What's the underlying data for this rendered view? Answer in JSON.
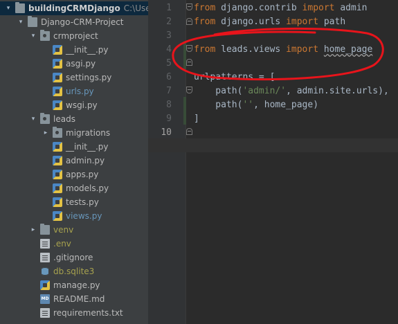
{
  "tree": {
    "items": [
      {
        "label": "buildingCRMDjango",
        "path": "C:\\Users\\d",
        "kind": "folder",
        "arrow": "▾",
        "style": "bold"
      },
      {
        "label": "Django-CRM-Project",
        "kind": "folder",
        "arrow": "▾"
      },
      {
        "label": "crmproject",
        "kind": "pkg",
        "arrow": "▾"
      },
      {
        "label": "__init__.py",
        "kind": "py"
      },
      {
        "label": "asgi.py",
        "kind": "py"
      },
      {
        "label": "settings.py",
        "kind": "py"
      },
      {
        "label": "urls.py",
        "kind": "py",
        "style": "blue"
      },
      {
        "label": "wsgi.py",
        "kind": "py"
      },
      {
        "label": "leads",
        "kind": "pkg",
        "arrow": "▾"
      },
      {
        "label": "migrations",
        "kind": "pkg",
        "arrow": "▸"
      },
      {
        "label": "__init__.py",
        "kind": "py"
      },
      {
        "label": "admin.py",
        "kind": "py"
      },
      {
        "label": "apps.py",
        "kind": "py"
      },
      {
        "label": "models.py",
        "kind": "py"
      },
      {
        "label": "tests.py",
        "kind": "py"
      },
      {
        "label": "views.py",
        "kind": "py",
        "style": "blue"
      },
      {
        "label": "venv",
        "kind": "folder",
        "arrow": "▸",
        "style": "olive"
      },
      {
        "label": ".env",
        "kind": "txt",
        "style": "olive"
      },
      {
        "label": ".gitignore",
        "kind": "txt"
      },
      {
        "label": "db.sqlite3",
        "kind": "db",
        "style": "olive"
      },
      {
        "label": "manage.py",
        "kind": "py"
      },
      {
        "label": "README.md",
        "kind": "md",
        "icon_text": "MD"
      },
      {
        "label": "requirements.txt",
        "kind": "txt"
      }
    ]
  },
  "editor": {
    "line_numbers": [
      "1",
      "2",
      "3",
      "4",
      "5",
      "6",
      "7",
      "8",
      "9",
      "10"
    ],
    "lines": [
      [
        {
          "t": "from",
          "c": "kw"
        },
        {
          "t": " django.contrib "
        },
        {
          "t": "import",
          "c": "kw"
        },
        {
          "t": " admin"
        }
      ],
      [
        {
          "t": "from",
          "c": "kw"
        },
        {
          "t": " django.urls "
        },
        {
          "t": "import",
          "c": "kw"
        },
        {
          "t": " path"
        }
      ],
      [],
      [
        {
          "t": "from",
          "c": "kw"
        },
        {
          "t": " leads.views "
        },
        {
          "t": "import",
          "c": "kw"
        },
        {
          "t": " "
        },
        {
          "t": "home_page",
          "c": "uline"
        }
      ],
      [],
      [
        {
          "t": "urlpatterns = ["
        }
      ],
      [
        {
          "t": "    path("
        },
        {
          "t": "'admin/'",
          "c": "str"
        },
        {
          "t": ", admin.site.urls),"
        }
      ],
      [
        {
          "t": "    path("
        },
        {
          "t": "''",
          "c": "str"
        },
        {
          "t": ", home_page)"
        }
      ],
      [
        {
          "t": "]"
        }
      ],
      []
    ],
    "current_line": "10",
    "annotation_color": "#e8141b"
  },
  "colors": {
    "accent": "#6897bb",
    "keyword": "#cc7832",
    "string": "#6a8759"
  }
}
